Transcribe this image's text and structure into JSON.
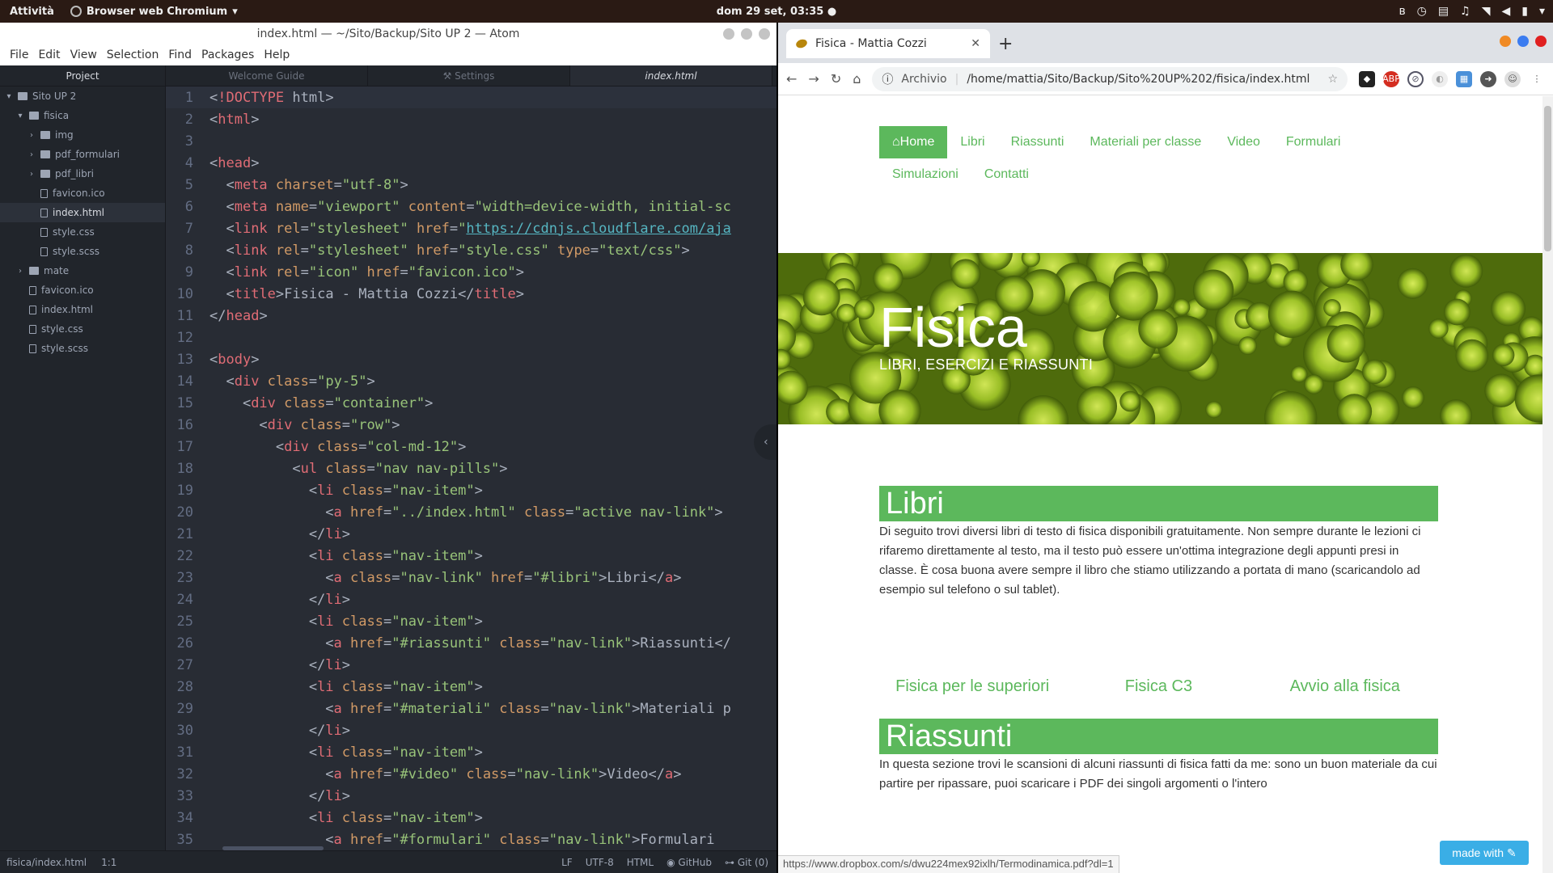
{
  "topbar": {
    "activities": "Attività",
    "app_name": "Browser web Chromium",
    "clock": "dom 29 set, 03:35 ●"
  },
  "atom": {
    "title": "index.html — ~/Sito/Backup/Sito UP 2 — Atom",
    "menu": [
      "File",
      "Edit",
      "View",
      "Selection",
      "Find",
      "Packages",
      "Help"
    ],
    "tree_header": "Project",
    "tree": [
      {
        "label": "Sito UP 2",
        "type": "folder",
        "depth": 0,
        "expanded": true
      },
      {
        "label": "fisica",
        "type": "folder",
        "depth": 1,
        "expanded": true
      },
      {
        "label": "img",
        "type": "folder",
        "depth": 2,
        "expanded": false
      },
      {
        "label": "pdf_formulari",
        "type": "folder",
        "depth": 2,
        "expanded": false
      },
      {
        "label": "pdf_libri",
        "type": "folder",
        "depth": 2,
        "expanded": false
      },
      {
        "label": "favicon.ico",
        "type": "file",
        "depth": 2
      },
      {
        "label": "index.html",
        "type": "file",
        "depth": 2,
        "selected": true
      },
      {
        "label": "style.css",
        "type": "file",
        "depth": 2
      },
      {
        "label": "style.scss",
        "type": "file",
        "depth": 2
      },
      {
        "label": "mate",
        "type": "folder",
        "depth": 1,
        "expanded": false
      },
      {
        "label": "favicon.ico",
        "type": "file",
        "depth": 1
      },
      {
        "label": "index.html",
        "type": "file",
        "depth": 1
      },
      {
        "label": "style.css",
        "type": "file",
        "depth": 1
      },
      {
        "label": "style.scss",
        "type": "file",
        "depth": 1
      }
    ],
    "tabs": [
      {
        "label": "Welcome Guide",
        "active": false
      },
      {
        "label": "⚒ Settings",
        "active": false
      },
      {
        "label": "index.html",
        "active": true
      }
    ],
    "code": [
      "<!DOCTYPE html>",
      "<html>",
      "",
      "<head>",
      "  <meta charset=\"utf-8\">",
      "  <meta name=\"viewport\" content=\"width=device-width, initial-sc",
      "  <link rel=\"stylesheet\" href=\"https://cdnjs.cloudflare.com/aja",
      "  <link rel=\"stylesheet\" href=\"style.css\" type=\"text/css\">",
      "  <link rel=\"icon\" href=\"favicon.ico\">",
      "  <title>Fisica - Mattia Cozzi</title>",
      "</head>",
      "",
      "<body>",
      "  <div class=\"py-5\">",
      "    <div class=\"container\">",
      "      <div class=\"row\">",
      "        <div class=\"col-md-12\">",
      "          <ul class=\"nav nav-pills\">",
      "            <li class=\"nav-item\">",
      "              <a href=\"../index.html\" class=\"active nav-link\">",
      "            </li>",
      "            <li class=\"nav-item\">",
      "              <a class=\"nav-link\" href=\"#libri\">Libri</a>",
      "            </li>",
      "            <li class=\"nav-item\">",
      "              <a href=\"#riassunti\" class=\"nav-link\">Riassunti</",
      "            </li>",
      "            <li class=\"nav-item\">",
      "              <a href=\"#materiali\" class=\"nav-link\">Materiali p",
      "            </li>",
      "            <li class=\"nav-item\">",
      "              <a href=\"#video\" class=\"nav-link\">Video</a>",
      "            </li>",
      "            <li class=\"nav-item\">",
      "              <a href=\"#formulari\" class=\"nav-link\">Formulari"
    ],
    "status": {
      "path": "fisica/index.html",
      "cursor": "1:1",
      "eol": "LF",
      "encoding": "UTF-8",
      "grammar": "HTML",
      "github": "GitHub",
      "git": "Git (0)"
    }
  },
  "chrome": {
    "tab_title": "Fisica - Mattia Cozzi",
    "omnibox_chip": "Archivio",
    "url": "/home/mattia/Sito/Backup/Sito%20UP%202/fisica/index.html",
    "status_url": "https://www.dropbox.com/s/dwu224mex92ixlh/Termodinamica.pdf?dl=1",
    "made_with": "made with"
  },
  "page": {
    "nav": [
      {
        "label": "Home",
        "active": true
      },
      {
        "label": "Libri"
      },
      {
        "label": "Riassunti"
      },
      {
        "label": "Materiali per classe"
      },
      {
        "label": "Video"
      },
      {
        "label": "Formulari"
      },
      {
        "label": "Simulazioni"
      },
      {
        "label": "Contatti"
      }
    ],
    "hero_title": "Fisica",
    "hero_subtitle": "LIBRI, ESERCIZI E RIASSUNTI",
    "libri_title": "Libri",
    "libri_text": "Di seguito trovi diversi libri di testo di fisica disponibili gratuitamente. Non sempre durante le lezioni ci rifaremo direttamente al testo, ma il testo può essere un'ottima integrazione degli appunti presi in classe. È cosa buona avere sempre il libro che stiamo utilizzando a portata di mano (scaricandolo ad esempio sul telefono o sul tablet).",
    "books": [
      "Fisica per le superiori",
      "Fisica C3",
      "Avvio alla fisica"
    ],
    "riassunti_title": "Riassunti",
    "riassunti_text": "In questa sezione trovi le scansioni di alcuni riassunti di fisica fatti da me: sono un buon materiale da cui partire per ripassare, puoi scaricare i PDF dei singoli argomenti o l'intero"
  }
}
